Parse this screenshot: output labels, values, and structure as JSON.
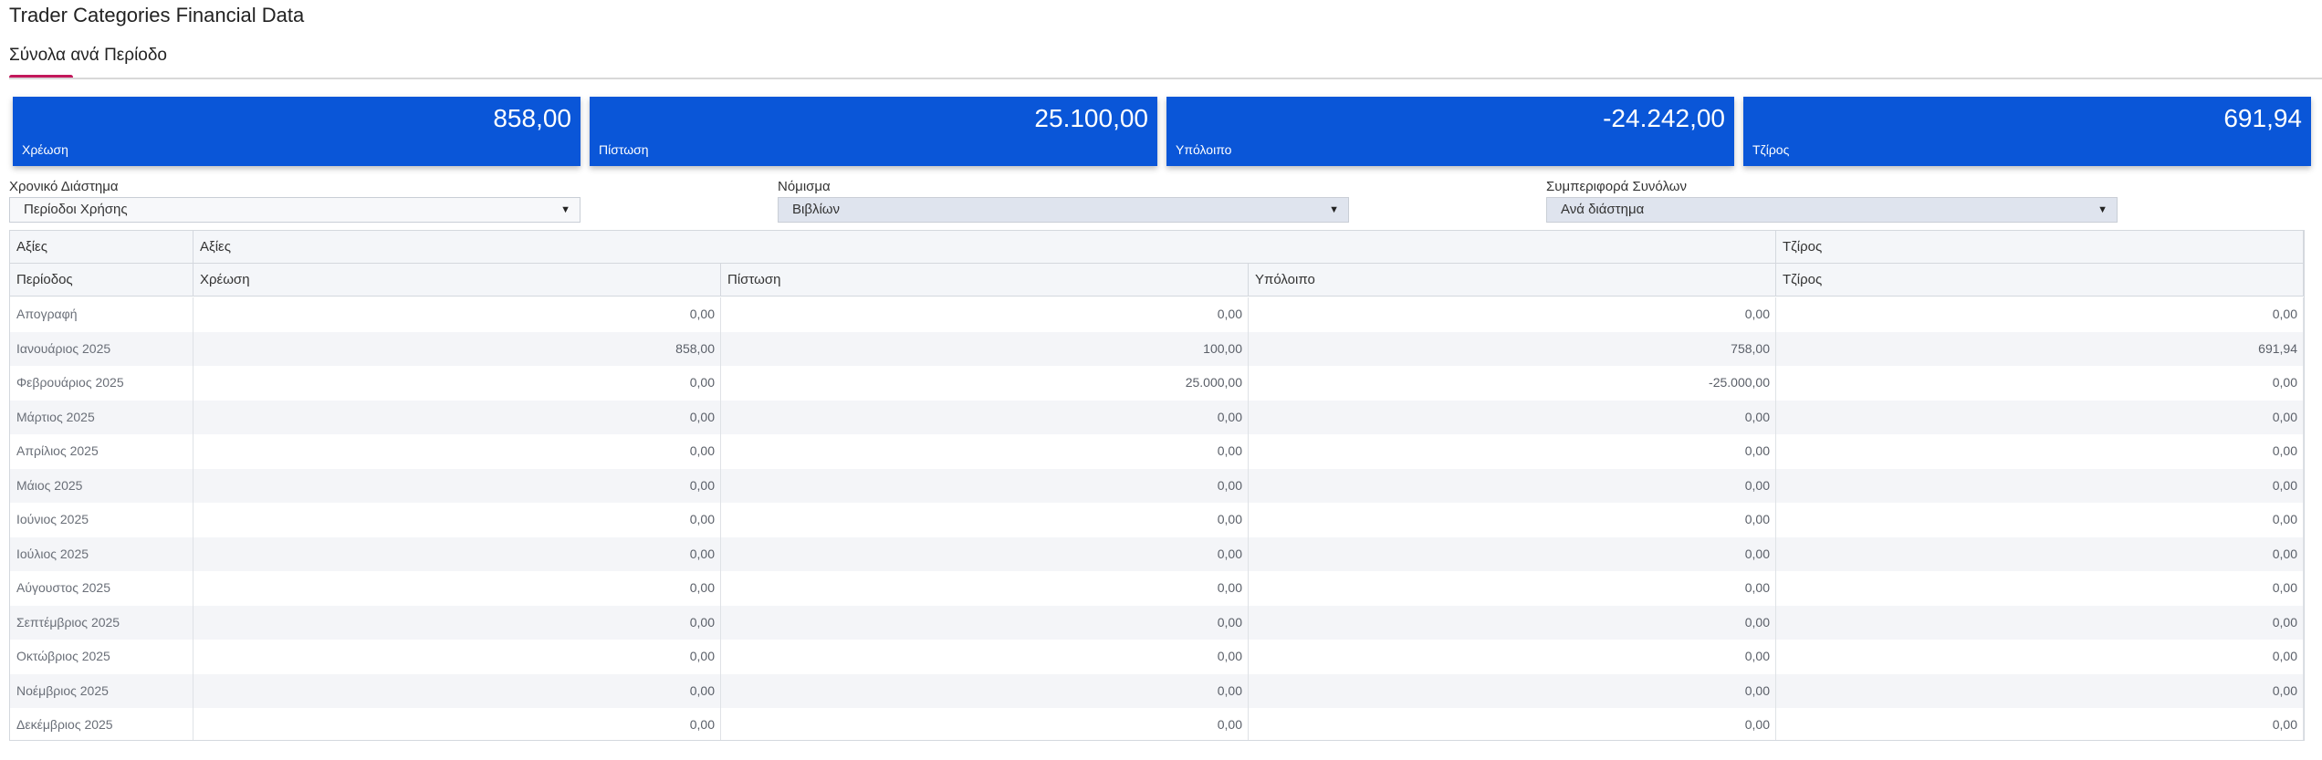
{
  "page": {
    "title": "Trader Categories Financial Data"
  },
  "tabs": [
    {
      "label": "Σύνολα ανά Περίοδο",
      "active": true
    }
  ],
  "cards": [
    {
      "value": "858,00",
      "label": "Χρέωση"
    },
    {
      "value": "25.100,00",
      "label": "Πίστωση"
    },
    {
      "value": "-24.242,00",
      "label": "Υπόλοιπο"
    },
    {
      "value": "691,94",
      "label": "Τζίρος"
    }
  ],
  "filters": {
    "period": {
      "label": "Χρονικό Διάστημα",
      "value": "Περίοδοι Χρήσης"
    },
    "currency": {
      "label": "Νόμισμα",
      "value": "Βιβλίων"
    },
    "behavior": {
      "label": "Συμπεριφορά Συνόλων",
      "value": "Ανά διάστημα"
    }
  },
  "colors": {
    "card_bg": "#0a56d8",
    "tab_accent": "#c2185b"
  },
  "table": {
    "group_headers": {
      "axes": "Αξίες",
      "values": "Αξίες",
      "turnover": "Τζίρος"
    },
    "columns": {
      "period": "Περίοδος",
      "debit": "Χρέωση",
      "credit": "Πίστωση",
      "balance": "Υπόλοιπο",
      "turnover": "Τζίρος"
    },
    "rows": [
      {
        "period": "Απογραφή",
        "debit": "0,00",
        "credit": "0,00",
        "balance": "0,00",
        "turnover": "0,00"
      },
      {
        "period": "Ιανουάριος 2025",
        "debit": "858,00",
        "credit": "100,00",
        "balance": "758,00",
        "turnover": "691,94"
      },
      {
        "period": "Φεβρουάριος 2025",
        "debit": "0,00",
        "credit": "25.000,00",
        "balance": "-25.000,00",
        "turnover": "0,00"
      },
      {
        "period": "Μάρτιος 2025",
        "debit": "0,00",
        "credit": "0,00",
        "balance": "0,00",
        "turnover": "0,00"
      },
      {
        "period": "Απρίλιος 2025",
        "debit": "0,00",
        "credit": "0,00",
        "balance": "0,00",
        "turnover": "0,00"
      },
      {
        "period": "Μάιος 2025",
        "debit": "0,00",
        "credit": "0,00",
        "balance": "0,00",
        "turnover": "0,00"
      },
      {
        "period": "Ιούνιος 2025",
        "debit": "0,00",
        "credit": "0,00",
        "balance": "0,00",
        "turnover": "0,00"
      },
      {
        "period": "Ιούλιος 2025",
        "debit": "0,00",
        "credit": "0,00",
        "balance": "0,00",
        "turnover": "0,00"
      },
      {
        "period": "Αύγουστος 2025",
        "debit": "0,00",
        "credit": "0,00",
        "balance": "0,00",
        "turnover": "0,00"
      },
      {
        "period": "Σεπτέμβριος 2025",
        "debit": "0,00",
        "credit": "0,00",
        "balance": "0,00",
        "turnover": "0,00"
      },
      {
        "period": "Οκτώβριος 2025",
        "debit": "0,00",
        "credit": "0,00",
        "balance": "0,00",
        "turnover": "0,00"
      },
      {
        "period": "Νοέμβριος 2025",
        "debit": "0,00",
        "credit": "0,00",
        "balance": "0,00",
        "turnover": "0,00"
      },
      {
        "period": "Δεκέμβριος 2025",
        "debit": "0,00",
        "credit": "0,00",
        "balance": "0,00",
        "turnover": "0,00"
      }
    ]
  }
}
